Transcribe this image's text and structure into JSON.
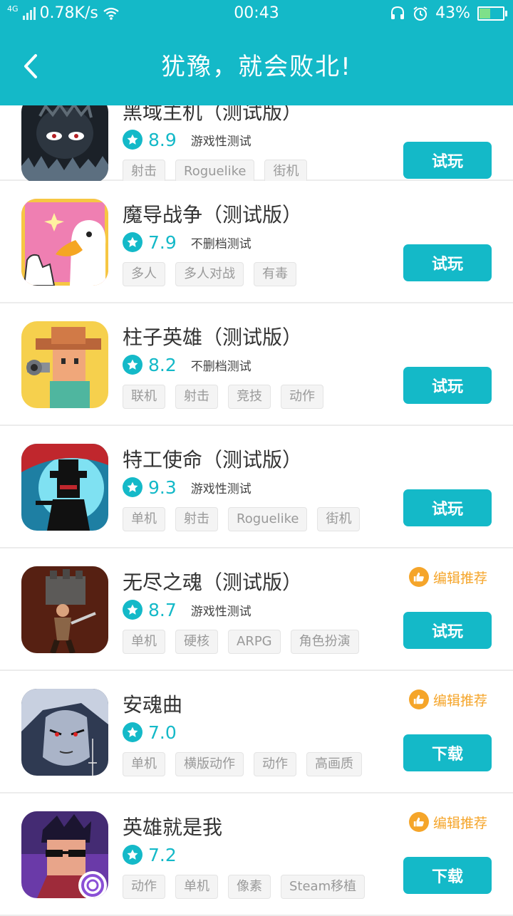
{
  "status_bar": {
    "network": "4G",
    "speed": "0.78K/s",
    "time": "00:43",
    "battery_percent": "43%",
    "battery_level": 0.43
  },
  "header": {
    "title": "犹豫，就会败北!"
  },
  "colors": {
    "accent": "#14b9c8",
    "recommend": "#f5a52a"
  },
  "games": [
    {
      "name": "黑域主机（测试版）",
      "score": "8.9",
      "subtitle": "游戏性测试",
      "tags": [
        "射击",
        "Roguelike",
        "街机"
      ],
      "button": "试玩",
      "recommend": "",
      "icon": "dark-creature-icon"
    },
    {
      "name": "魔导战争（测试版）",
      "score": "7.9",
      "subtitle": "不删档测试",
      "tags": [
        "多人",
        "多人对战",
        "有毒"
      ],
      "button": "试玩",
      "recommend": "",
      "icon": "duck-icon"
    },
    {
      "name": "柱子英雄（测试版）",
      "score": "8.2",
      "subtitle": "不删档测试",
      "tags": [
        "联机",
        "射击",
        "竞技",
        "动作"
      ],
      "button": "试玩",
      "recommend": "",
      "icon": "cowboy-icon"
    },
    {
      "name": "特工使命（测试版）",
      "score": "9.3",
      "subtitle": "游戏性测试",
      "tags": [
        "单机",
        "射击",
        "Roguelike",
        "街机"
      ],
      "button": "试玩",
      "recommend": "",
      "icon": "silhouette-agent-icon"
    },
    {
      "name": "无尽之魂（测试版）",
      "score": "8.7",
      "subtitle": "游戏性测试",
      "tags": [
        "单机",
        "硬核",
        "ARPG",
        "角色扮演"
      ],
      "button": "试玩",
      "recommend": "编辑推荐",
      "icon": "warrior-icon"
    },
    {
      "name": "安魂曲",
      "score": "7.0",
      "subtitle": "",
      "tags": [
        "单机",
        "横版动作",
        "动作",
        "高画质"
      ],
      "button": "下载",
      "recommend": "编辑推荐",
      "icon": "vampire-icon"
    },
    {
      "name": "英雄就是我",
      "score": "7.2",
      "subtitle": "",
      "tags": [
        "动作",
        "单机",
        "像素",
        "Steam移植"
      ],
      "button": "下载",
      "recommend": "编辑推荐",
      "icon": "sunglasses-hero-icon"
    }
  ]
}
